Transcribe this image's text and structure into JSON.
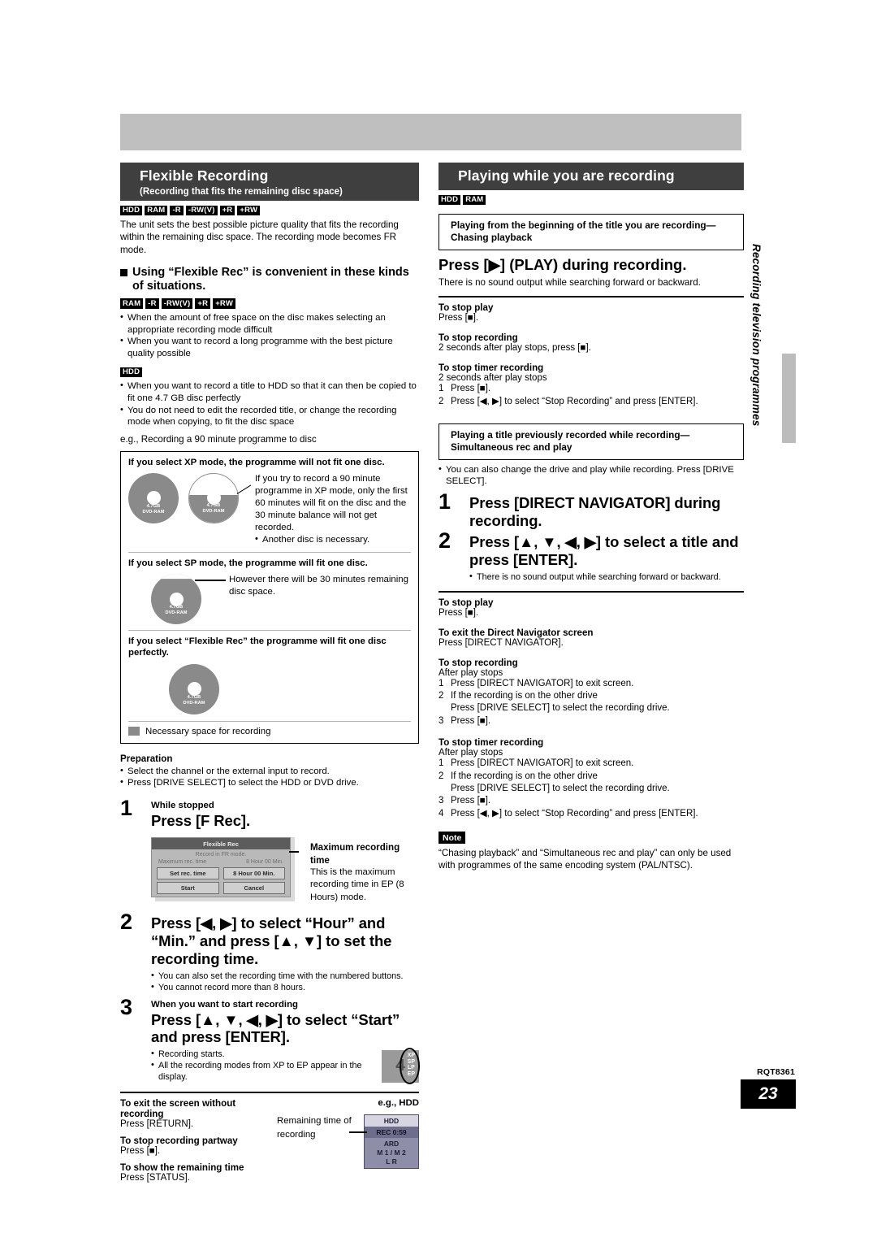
{
  "page": {
    "number": "23",
    "doc_code": "RQT8361",
    "side_tab": "Recording television programmes"
  },
  "left": {
    "section": {
      "title": "Flexible Recording",
      "subtitle": "(Recording that fits the remaining disc space)"
    },
    "tags_main": [
      "HDD",
      "RAM",
      "-R",
      "-RW(V)",
      "+R",
      "+RW"
    ],
    "intro": "The unit sets the best possible picture quality that fits the recording within the remaining disc space. The recording mode becomes FR mode.",
    "subhead": "Using “Flexible Rec” is convenient in these kinds of situations.",
    "tags_sub": [
      "RAM",
      "-R",
      "-RW(V)",
      "+R",
      "+RW"
    ],
    "bullets_disc": [
      "When the amount of free space on the disc makes selecting an appropriate recording mode difficult",
      "When you want to record a long programme with the best picture quality possible"
    ],
    "tag_hdd": "HDD",
    "bullets_hdd": [
      "When you want to record a title to HDD so that it can then be copied to fit one 4.7 GB disc perfectly",
      "You do not need to edit the recorded title, or change the recording mode when copying, to fit the disc space"
    ],
    "eg_line": "e.g., Recording a 90 minute programme to disc",
    "ill": {
      "xp_caption": "If you select XP mode, the programme will not fit one disc.",
      "xp_text": "If you try to record a 90 minute programme in XP mode, only the first 60 minutes will fit on the disc and the 30 minute balance will not get recorded.",
      "xp_bullet": "Another disc is necessary.",
      "sp_caption": "If you select SP mode, the programme will fit one disc.",
      "sp_text": "However there will be 30 minutes remaining disc space.",
      "fr_caption": "If you select “Flexible Rec” the programme will fit one disc perfectly.",
      "disc_label_line1": "4.7GB",
      "disc_label_line2": "DVD-RAM",
      "legend": "Necessary space for recording"
    },
    "preparation": {
      "heading": "Preparation",
      "items": [
        "Select the channel or the external input to record.",
        "Press [DRIVE SELECT] to select the HDD or DVD drive."
      ]
    },
    "steps": [
      {
        "num": "1",
        "cond": "While stopped",
        "cmd": "Press [F Rec]."
      },
      {
        "num": "2",
        "cond": "",
        "cmd": "Press [◀, ▶] to select “Hour” and “Min.” and press [▲, ▼] to set the recording time.",
        "bullets": [
          "You can also set the recording time with the numbered buttons.",
          "You cannot record more than 8 hours."
        ]
      },
      {
        "num": "3",
        "cond": "When you want to start recording",
        "cmd": "Press [▲, ▼, ◀, ▶] to select “Start” and press [ENTER].",
        "bullets": [
          "Recording starts.",
          "All the recording modes from XP to EP appear in the display."
        ]
      }
    ],
    "osd": {
      "title": "Flexible Rec",
      "line1": "Record in FR mode.",
      "label_max": "Maximum rec. time",
      "value_max": "8 Hour 00 Min.",
      "btn_set": "Set rec. time",
      "value_set": "8 Hour 00 Min.",
      "btn_start": "Start",
      "btn_cancel": "Cancel",
      "callout_title": "Maximum recording time",
      "callout_text": "This is the maximum recording time in EP (8 Hours) mode."
    },
    "fl_display": {
      "digit": "4",
      "modes": [
        "XP",
        "SP",
        "LP",
        "EP"
      ]
    },
    "footer": [
      {
        "h": "To exit the screen without recording",
        "p": "Press [RETURN]."
      },
      {
        "h": "To stop recording partway",
        "p": "Press [■]."
      },
      {
        "h": "To show the remaining time",
        "p": "Press [STATUS]."
      }
    ],
    "hdd_example": {
      "title": "e.g., HDD",
      "callout": "Remaining time of recording",
      "rows": [
        "HDD",
        "REC 0:59",
        "ARD",
        "M 1 / M 2",
        "L R"
      ]
    }
  },
  "right": {
    "section": {
      "title": "Playing while you are recording"
    },
    "tags": [
      "HDD",
      "RAM"
    ],
    "block1": {
      "boxtitle": "Playing from the beginning of the title you are recording—Chasing playback",
      "cmd": "Press [▶] (PLAY) during recording.",
      "note": "There is no sound output while searching forward or backward.",
      "footers": [
        {
          "h": "To stop play",
          "p": "Press [■]."
        },
        {
          "h": "To stop recording",
          "p": "2 seconds after play stops, press [■]."
        },
        {
          "h": "To stop timer recording",
          "p": "2 seconds after play stops",
          "steps": [
            "Press [■].",
            "Press [◀, ▶] to select “Stop Recording” and press [ENTER]."
          ]
        }
      ]
    },
    "block2": {
      "boxtitle": "Playing a title previously recorded while recording—Simultaneous rec and play",
      "bullet": "You can also change the drive and play while recording. Press [DRIVE SELECT].",
      "steps": [
        {
          "num": "1",
          "cmd": "Press [DIRECT NAVIGATOR] during recording."
        },
        {
          "num": "2",
          "cmd": "Press [▲, ▼, ◀, ▶] to select a title and press [ENTER].",
          "bullets": [
            "There is no sound output while searching forward or backward."
          ]
        }
      ],
      "footers": [
        {
          "h": "To stop play",
          "p": "Press [■]."
        },
        {
          "h": "To exit the Direct Navigator screen",
          "p": "Press [DIRECT NAVIGATOR]."
        },
        {
          "h": "To stop recording",
          "p": "After play stops",
          "steps": [
            "Press [DIRECT NAVIGATOR] to exit screen.",
            "If the recording is on the other drive|Press [DRIVE SELECT] to select the recording drive.",
            "Press [■]."
          ]
        },
        {
          "h": "To stop timer recording",
          "p": "After play stops",
          "steps": [
            "Press [DIRECT NAVIGATOR] to exit screen.",
            "If the recording is on the other drive|Press [DRIVE SELECT] to select the recording drive.",
            "Press [■].",
            "Press [◀, ▶] to select “Stop Recording” and press [ENTER]."
          ]
        }
      ]
    },
    "note": {
      "tag": "Note",
      "text": "“Chasing playback” and “Simultaneous rec and play” can only be used with programmes of the same encoding system (PAL/NTSC)."
    }
  }
}
